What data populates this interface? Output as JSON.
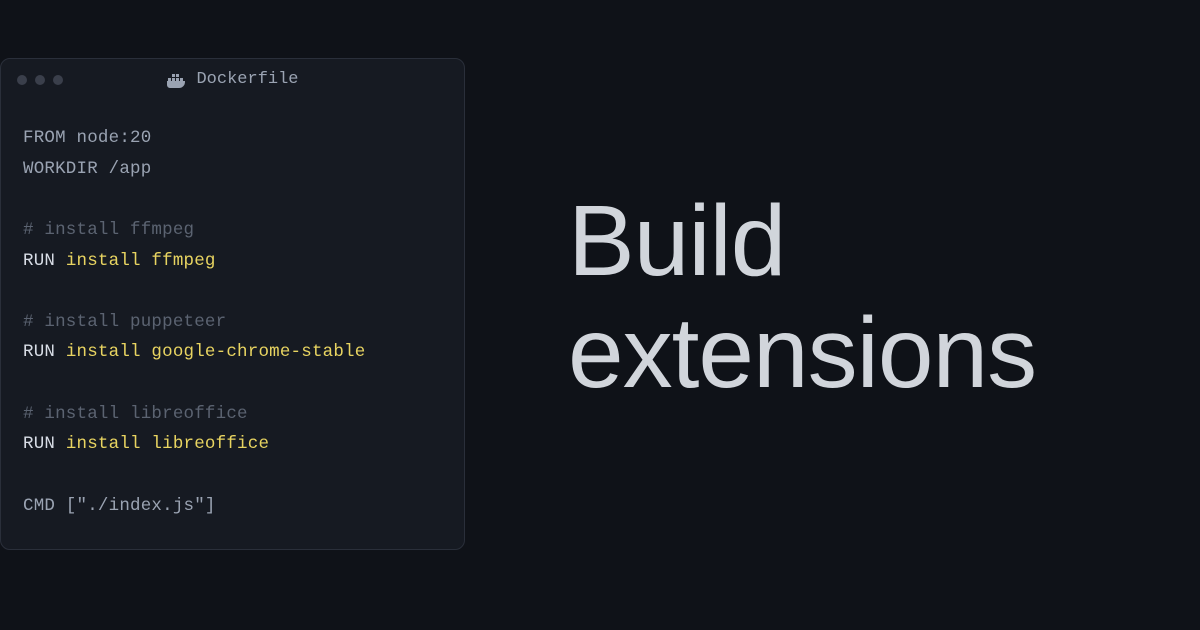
{
  "window": {
    "title": "Dockerfile",
    "icon": "docker-icon"
  },
  "code": {
    "lines": [
      {
        "type": "plain",
        "tokens": [
          {
            "cls": "tok-gray",
            "text": "FROM node:20"
          }
        ]
      },
      {
        "type": "plain",
        "tokens": [
          {
            "cls": "tok-gray",
            "text": "WORKDIR /app"
          }
        ]
      },
      {
        "type": "blank"
      },
      {
        "type": "plain",
        "tokens": [
          {
            "cls": "tok-comment",
            "text": "# install ffmpeg"
          }
        ]
      },
      {
        "type": "plain",
        "tokens": [
          {
            "cls": "tok-white",
            "text": "RUN "
          },
          {
            "cls": "tok-yellow",
            "text": "install ffmpeg"
          }
        ]
      },
      {
        "type": "blank"
      },
      {
        "type": "plain",
        "tokens": [
          {
            "cls": "tok-comment",
            "text": "# install puppeteer"
          }
        ]
      },
      {
        "type": "plain",
        "tokens": [
          {
            "cls": "tok-white",
            "text": "RUN "
          },
          {
            "cls": "tok-yellow",
            "text": "install google-chrome-stable"
          }
        ]
      },
      {
        "type": "blank"
      },
      {
        "type": "plain",
        "tokens": [
          {
            "cls": "tok-comment",
            "text": "# install libreoffice"
          }
        ]
      },
      {
        "type": "plain",
        "tokens": [
          {
            "cls": "tok-white",
            "text": "RUN "
          },
          {
            "cls": "tok-yellow",
            "text": "install libreoffice"
          }
        ]
      },
      {
        "type": "blank"
      },
      {
        "type": "plain",
        "tokens": [
          {
            "cls": "tok-gray",
            "text": "CMD [\"./index.js\"]"
          }
        ]
      }
    ]
  },
  "headline": {
    "line1": "Build",
    "line2": "extensions"
  }
}
